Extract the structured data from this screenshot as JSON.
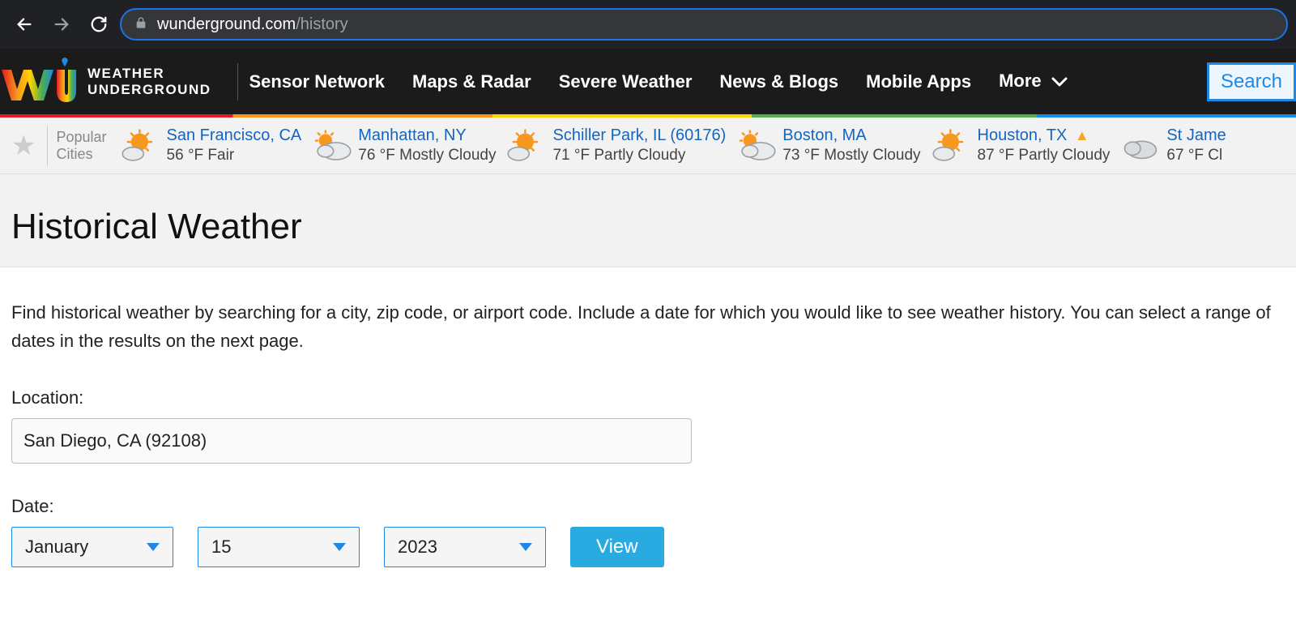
{
  "browser": {
    "url_domain": "wunderground.com",
    "url_path": "/history"
  },
  "header": {
    "logo_line1": "WEATHER",
    "logo_line2": "UNDERGROUND",
    "nav": [
      "Sensor Network",
      "Maps & Radar",
      "Severe Weather",
      "News & Blogs",
      "Mobile Apps"
    ],
    "more_label": "More",
    "search_label": "Search"
  },
  "strip": {
    "popular_line1": "Popular",
    "popular_line2": "Cities",
    "cities": [
      {
        "name": "San Francisco, CA",
        "cond": "56 °F Fair",
        "icon": "sun-cloud",
        "alert": false
      },
      {
        "name": "Manhattan, NY",
        "cond": "76 °F Mostly Cloudy",
        "icon": "cloud-sun",
        "alert": false
      },
      {
        "name": "Schiller Park, IL (60176)",
        "cond": "71 °F Partly Cloudy",
        "icon": "sun-cloud",
        "alert": false
      },
      {
        "name": "Boston, MA",
        "cond": "73 °F Mostly Cloudy",
        "icon": "cloud-sun",
        "alert": false
      },
      {
        "name": "Houston, TX",
        "cond": "87 °F Partly Cloudy",
        "icon": "sun-cloud",
        "alert": true
      },
      {
        "name": "St Jame",
        "cond": "67 °F Cl",
        "icon": "cloud",
        "alert": false
      }
    ]
  },
  "page": {
    "title": "Historical Weather",
    "intro": "Find historical weather by searching for a city, zip code, or airport code. Include a date for which you would like to see weather history. You can select a range of dates in the results on the next page.",
    "location_label": "Location:",
    "location_value": "San Diego, CA (92108)",
    "date_label": "Date:",
    "month_value": "January",
    "day_value": "15",
    "year_value": "2023",
    "view_label": "View"
  }
}
